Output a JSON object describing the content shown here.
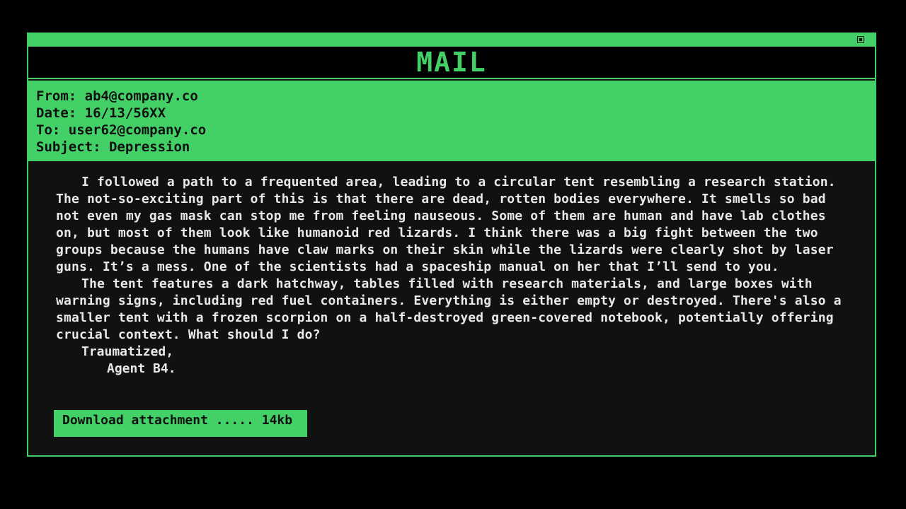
{
  "app": {
    "title": "MAIL"
  },
  "colors": {
    "accent": "#43d167",
    "background": "#000000",
    "panel": "#111111",
    "text": "#e8e8e8"
  },
  "email": {
    "from": "From: ab4@company.co",
    "date": "Date: 16/13/56XX",
    "to": "To: user62@company.co",
    "subject": "Subject: Depression",
    "paragraphs": [
      "I followed a path to a frequented area, leading to a circular tent resembling a research station. The not-so-exciting part of this is that there are dead, rotten bodies everywhere. It smells so bad not even my gas mask can stop me from feeling nauseous. Some of them are human and have lab clothes on, but most of them look like humanoid red lizards. I think there was a big fight between the two groups because the humans have claw marks on their skin while the lizards were clearly shot by laser guns. It’s a mess. One of the scientists had a spaceship manual on her that I’ll send to you.",
      "The tent features a dark hatchway, tables filled with research materials, and large boxes with warning signs, including red fuel containers. Everything is either empty or destroyed. There's also a smaller tent with a frozen scorpion on a half-destroyed green-covered notebook, potentially offering crucial context. What should I do?"
    ],
    "signoff": "Traumatized,",
    "signature": "Agent B4."
  },
  "attachment": {
    "label": "Download attachment ..... 14kb"
  },
  "icons": {
    "close": "close-icon"
  }
}
